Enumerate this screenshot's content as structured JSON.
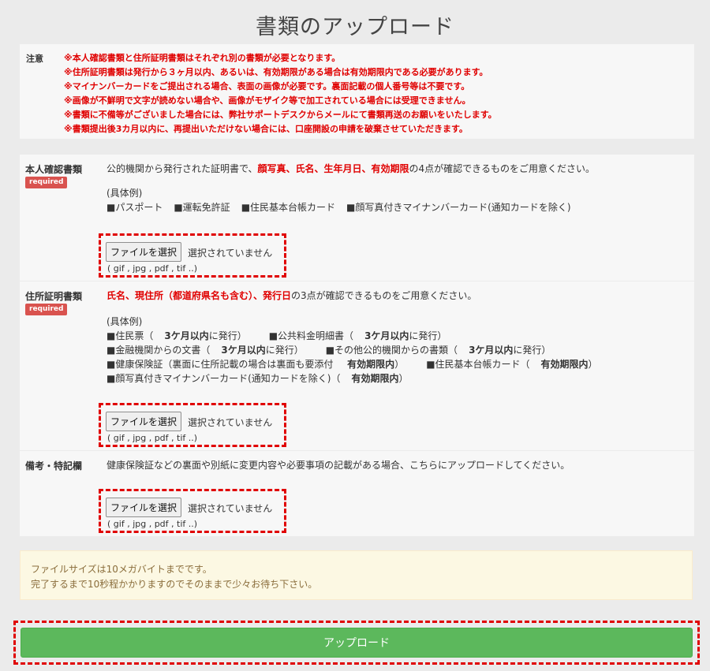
{
  "page": {
    "title": "書類のアップロード"
  },
  "notice": {
    "label": "注意",
    "lines": [
      "※本人確認書類と住所証明書類はそれぞれ別の書類が必要となります。",
      "※住所証明書類は発行から３ヶ月以内、あるいは、有効期限がある場合は有効期限内である必要があります。",
      "※マイナンバーカードをご提出される場合、表面の画像が必要です。裏面記載の個人番号等は不要です。",
      "※画像が不鮮明で文字が読めない場合や、画像がモザイク等で加工されている場合には受理できません。",
      "※書類に不備等がございました場合には、弊社サポートデスクからメールにて書類再送のお願いをいたします。",
      "※書類提出後3カ月以内に、再提出いただけない場合には、口座開設の申請を破棄させていただきます。"
    ]
  },
  "identity": {
    "label": "本人確認書類",
    "badge": "required",
    "desc_prefix": "公的機関から発行された証明書で、",
    "desc_red": "顔写真、氏名、生年月日、有効期限",
    "desc_suffix": "の4点が確認できるものをご用意ください。",
    "examples_title": "(具体例)",
    "examples": [
      "■パスポート",
      "■運転免許証",
      "■住民基本台帳カード",
      "■顔写真付きマイナンバーカード(通知カードを除く)"
    ],
    "file_button": "ファイルを選択",
    "file_status": "選択されていません",
    "extensions": "( gif , jpg , pdf , tif ..)"
  },
  "address": {
    "label": "住所証明書類",
    "badge": "required",
    "desc_red": "氏名、現住所（都道府県名も含む）、発行日",
    "desc_suffix": "の3点が確認できるものをご用意ください。",
    "examples_title": "(具体例)",
    "ex1a": "■住民票（",
    "ex1b": "3ケ月以内",
    "ex1c": "に発行）",
    "ex2a": "■公共料金明細書（",
    "ex2b": "3ケ月以内",
    "ex2c": "に発行）",
    "ex3a": "■金融機関からの文書（",
    "ex3b": "3ケ月以内",
    "ex3c": "に発行）",
    "ex4a": "■その他公的機関からの書類（",
    "ex4b": "3ケ月以内",
    "ex4c": "に発行）",
    "ex5a": "■健康保険証（裏面に住所記載の場合は裏面も要添付 ",
    "ex5b": "有効期限内",
    "ex5c": "）",
    "ex6a": "■住民基本台帳カード（",
    "ex6b": "有効期限内",
    "ex6c": "）",
    "ex7a": "■顔写真付きマイナンバーカード(通知カードを除く)（",
    "ex7b": "有効期限内",
    "ex7c": "）",
    "file_button": "ファイルを選択",
    "file_status": "選択されていません",
    "extensions": "( gif , jpg , pdf , tif ..)"
  },
  "remarks": {
    "label": "備考・特記欄",
    "desc": "健康保険証などの裏面や別紙に変更内容や必要事項の記載がある場合、こちらにアップロードしてください。",
    "file_button": "ファイルを選択",
    "file_status": "選択されていません",
    "extensions": "( gif , jpg , pdf , tif ..)"
  },
  "info": {
    "line1": "ファイルサイズは10メガバイトまでです。",
    "line2": "完了するまで10秒程かかりますのでそのままで少々お待ち下さい。"
  },
  "submit": {
    "label": "アップロード"
  },
  "colors": {
    "required_badge": "#d9534f",
    "warning_text": "#e00000",
    "submit": "#5cb85c",
    "highlight_border": "#e00000"
  }
}
